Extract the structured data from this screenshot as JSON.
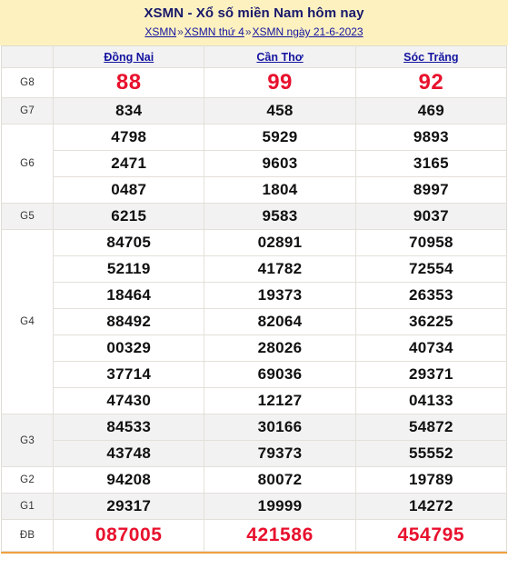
{
  "header": {
    "title": "XSMN - Xổ số miền Nam hôm nay",
    "breadcrumb": {
      "items": [
        "XSMN",
        "XSMN thứ 4",
        "XSMN ngày 21-6-2023"
      ],
      "separator": "»"
    }
  },
  "table": {
    "corner_label": "",
    "provinces": [
      "Đồng Nai",
      "Cần Thơ",
      "Sóc Trăng"
    ],
    "prizes": [
      {
        "label": "G8",
        "style": "red-large",
        "tone": "white",
        "rows": [
          [
            "88",
            "99",
            "92"
          ]
        ]
      },
      {
        "label": "G7",
        "style": "normal",
        "tone": "gray",
        "rows": [
          [
            "834",
            "458",
            "469"
          ]
        ]
      },
      {
        "label": "G6",
        "style": "normal",
        "tone": "white",
        "rows": [
          [
            "4798",
            "5929",
            "9893"
          ],
          [
            "2471",
            "9603",
            "3165"
          ],
          [
            "0487",
            "1804",
            "8997"
          ]
        ]
      },
      {
        "label": "G5",
        "style": "normal",
        "tone": "gray",
        "rows": [
          [
            "6215",
            "9583",
            "9037"
          ]
        ]
      },
      {
        "label": "G4",
        "style": "normal",
        "tone": "white",
        "rows": [
          [
            "84705",
            "02891",
            "70958"
          ],
          [
            "52119",
            "41782",
            "72554"
          ],
          [
            "18464",
            "19373",
            "26353"
          ],
          [
            "88492",
            "82064",
            "36225"
          ],
          [
            "00329",
            "28026",
            "40734"
          ],
          [
            "37714",
            "69036",
            "29371"
          ],
          [
            "47430",
            "12127",
            "04133"
          ]
        ]
      },
      {
        "label": "G3",
        "style": "normal",
        "tone": "gray",
        "rows": [
          [
            "84533",
            "30166",
            "54872"
          ],
          [
            "43748",
            "79373",
            "55552"
          ]
        ]
      },
      {
        "label": "G2",
        "style": "normal",
        "tone": "white",
        "rows": [
          [
            "94208",
            "80072",
            "19789"
          ]
        ]
      },
      {
        "label": "G1",
        "style": "normal",
        "tone": "gray",
        "rows": [
          [
            "29317",
            "19999",
            "14272"
          ]
        ]
      },
      {
        "label": "ĐB",
        "style": "red-db",
        "tone": "white",
        "rows": [
          [
            "087005",
            "421586",
            "454795"
          ]
        ]
      }
    ]
  },
  "colors": {
    "banner_bg": "#fdf1c0",
    "title": "#18186b",
    "link": "#1414a0",
    "red": "#e8112d",
    "row_gray": "#f2f2f2",
    "border": "#e3e0d9",
    "bottom_rule": "#f0a040"
  }
}
